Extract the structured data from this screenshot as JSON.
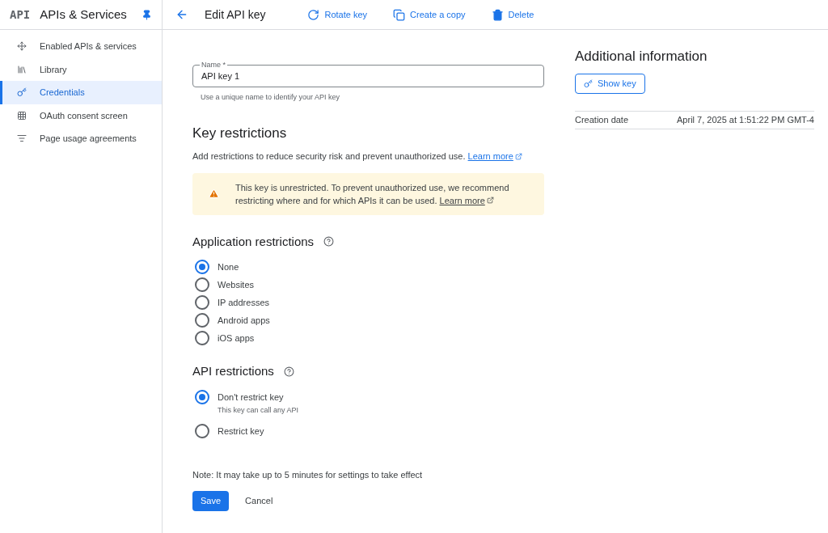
{
  "sidebar": {
    "logo": "API",
    "title": "APIs & Services",
    "items": [
      {
        "label": "Enabled APIs & services",
        "selected": false
      },
      {
        "label": "Library",
        "selected": false
      },
      {
        "label": "Credentials",
        "selected": true
      },
      {
        "label": "OAuth consent screen",
        "selected": false
      },
      {
        "label": "Page usage agreements",
        "selected": false
      }
    ]
  },
  "header": {
    "title": "Edit API key",
    "actions": [
      {
        "label": "Rotate key"
      },
      {
        "label": "Create a copy"
      },
      {
        "label": "Delete"
      }
    ]
  },
  "name_field": {
    "label": "Name *",
    "value": "API key 1",
    "hint": "Use a unique name to identify your API key"
  },
  "key_restrictions": {
    "title": "Key restrictions",
    "description": "Add restrictions to reduce security risk and prevent unauthorized use.",
    "link": "Learn more"
  },
  "warning": {
    "text": "This key is unrestricted. To prevent unauthorized use, we recommend restricting where and for which APIs it can be used.",
    "link": "Learn more"
  },
  "application_restrictions": {
    "title": "Application restrictions",
    "options": [
      {
        "label": "None",
        "selected": true
      },
      {
        "label": "Websites",
        "selected": false
      },
      {
        "label": "IP addresses",
        "selected": false
      },
      {
        "label": "Android apps",
        "selected": false
      },
      {
        "label": "iOS apps",
        "selected": false
      }
    ]
  },
  "api_restrictions": {
    "title": "API restrictions",
    "options": [
      {
        "label": "Don't restrict key",
        "sublabel": "This key can call any API",
        "selected": true
      },
      {
        "label": "Restrict key",
        "selected": false
      }
    ]
  },
  "note": "Note: It may take up to 5 minutes for settings to take effect",
  "buttons": {
    "save": "Save",
    "cancel": "Cancel"
  },
  "additional_info": {
    "title": "Additional information",
    "show_key": "Show key",
    "rows": [
      {
        "label": "Creation date",
        "value": "April 7, 2025 at 1:51:22 PM GMT-4"
      }
    ]
  }
}
